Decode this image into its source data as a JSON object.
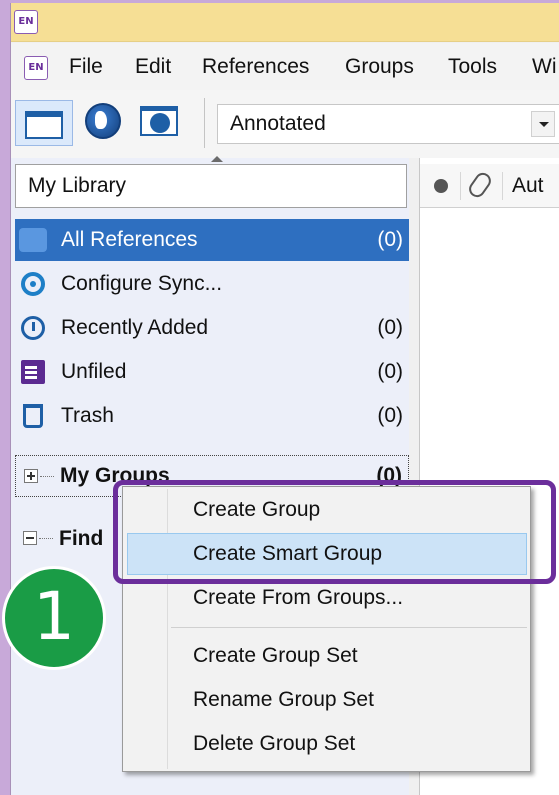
{
  "app": {
    "logo_text": "EN"
  },
  "menubar": {
    "items": [
      {
        "label": "File"
      },
      {
        "label": "Edit"
      },
      {
        "label": "References"
      },
      {
        "label": "Groups"
      },
      {
        "label": "Tools"
      },
      {
        "label": "Wi"
      }
    ]
  },
  "toolbar": {
    "library_mode": "Annotated",
    "icons": [
      "local-library-icon",
      "online-search-icon",
      "integrated-library-icon"
    ]
  },
  "left_pane": {
    "library_selector": "My Library",
    "items": [
      {
        "label": "All References",
        "count": "(0)",
        "icon": "all-references-icon",
        "selected": true
      },
      {
        "label": "Configure Sync...",
        "count": "",
        "icon": "sync-icon"
      },
      {
        "label": "Recently Added",
        "count": "(0)",
        "icon": "recently-added-icon"
      },
      {
        "label": "Unfiled",
        "count": "(0)",
        "icon": "unfiled-icon"
      },
      {
        "label": "Trash",
        "count": "(0)",
        "icon": "trash-icon"
      }
    ],
    "groups": {
      "label": "My Groups",
      "count": "(0)"
    },
    "find": {
      "label": "Find"
    }
  },
  "reference_list": {
    "columns": [
      {
        "icon": "read-status-icon"
      },
      {
        "icon": "attachment-icon"
      },
      {
        "label": "Aut"
      }
    ]
  },
  "context_menu": {
    "items": [
      {
        "label": "Create Group"
      },
      {
        "label": "Create Smart Group",
        "highlighted": true
      },
      {
        "label": "Create From Groups..."
      },
      {
        "label": "Create Group Set"
      },
      {
        "label": "Rename Group Set"
      },
      {
        "label": "Delete Group Set"
      }
    ]
  },
  "annotation": {
    "step_number": "1",
    "highlight_color": "#6b2e9b",
    "badge_color": "#1a9c46"
  }
}
